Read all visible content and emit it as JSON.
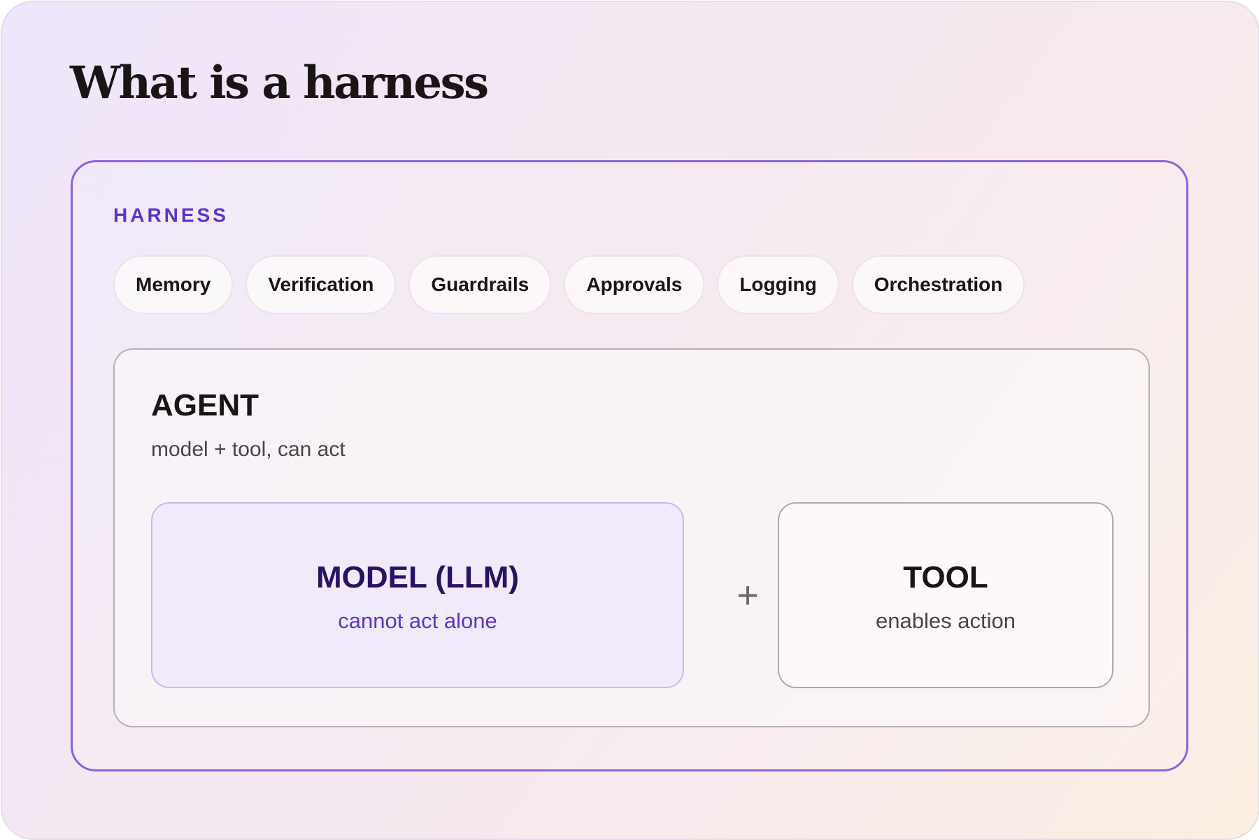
{
  "title": "What is a harness",
  "harness": {
    "label": "HARNESS",
    "chips": [
      "Memory",
      "Verification",
      "Guardrails",
      "Approvals",
      "Logging",
      "Orchestration"
    ]
  },
  "agent": {
    "title": "AGENT",
    "subtitle": "model + tool, can act",
    "model": {
      "title": "MODEL (LLM)",
      "subtitle": "cannot act alone"
    },
    "operator": "+",
    "tool": {
      "title": "TOOL",
      "subtitle": "enables action"
    }
  },
  "colors": {
    "accent": "#8b63e0",
    "label": "#5e33cc",
    "model_fill": "#f1eafb",
    "model_title": "#2b1162"
  }
}
